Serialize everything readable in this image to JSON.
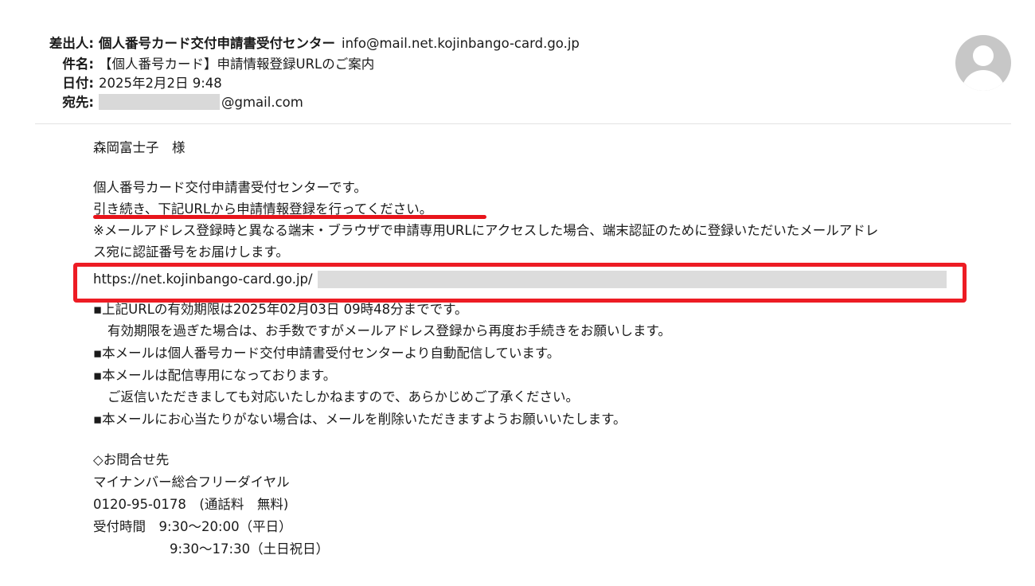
{
  "header": {
    "from_label": "差出人:",
    "from_name": "個人番号カード交付申請書受付センター",
    "from_email": "info@mail.net.kojinbango-card.go.jp",
    "subject_label": "件名:",
    "subject": "【個人番号カード】申請情報登録URLのご案内",
    "date_label": "日付:",
    "date": "2025年2月2日 9:48",
    "to_label": "宛先:",
    "to_email_suffix": "@gmail.com"
  },
  "avatar": {
    "icon": "person-icon"
  },
  "body": {
    "greeting": "森岡富士子　様",
    "intro": "個人番号カード交付申請書受付センターです。",
    "instruction": "引き続き、下記URLから申請情報登録を行ってください。",
    "note_line1": "※メールアドレス登録時と異なる端末・ブラウザで申請専用URLにアクセスした場合、端末認証のために登録いただいたメールアドレ",
    "note_line2": "ス宛に認証番号をお届けします。",
    "url": "https://net.kojinbango-card.go.jp/",
    "bullet1_line1": "▪上記URLの有効期限は2025年02月03日 09時48分までです。",
    "bullet1_line2": "有効期限を過ぎた場合は、お手数ですがメールアドレス登録から再度お手続きをお願いします。",
    "bullet2": "▪本メールは個人番号カード交付申請書受付センターより自動配信しています。",
    "bullet3_line1": "▪本メールは配信専用になっております。",
    "bullet3_line2": "ご返信いただきましても対応いたしかねますので、あらかじめご了承ください。",
    "bullet4": "▪本メールにお心当たりがない場合は、メールを削除いただきますようお願いいたします。",
    "contact_heading": "◇お問合せ先",
    "contact_name": "マイナンバー総合フリーダイヤル",
    "contact_phone": "0120-95-0178　(通話料　無料)",
    "hours_line1": "受付時間　9:30〜20:00（平日）",
    "hours_line2": "9:30〜17:30（土日祝日）"
  },
  "colors": {
    "highlight_red": "#ed1c24",
    "redaction_gray": "#d9d9d9"
  }
}
